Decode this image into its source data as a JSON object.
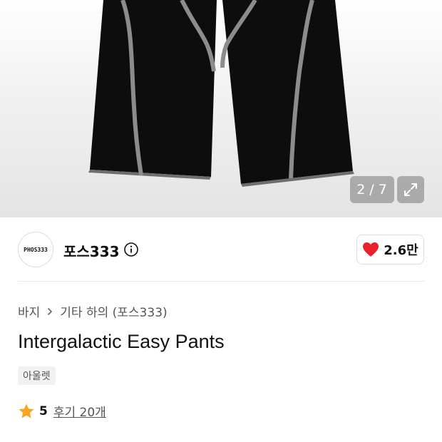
{
  "gallery": {
    "current": "2",
    "separator": "/",
    "total": "7",
    "expand_icon": "expand-arrows-icon"
  },
  "brand": {
    "logo_text": "PHOS333",
    "name": "포스333",
    "info_icon": "info-icon"
  },
  "likes": {
    "icon": "heart-icon",
    "count": "2.6만",
    "accent": "#e8212b"
  },
  "breadcrumb": {
    "items": [
      "바지",
      "기타 하의 (포스333)"
    ]
  },
  "product": {
    "title": "Intergalactic Easy Pants",
    "tag": "아울렛"
  },
  "rating": {
    "icon": "star-icon",
    "star_color": "#f5a623",
    "value": "5",
    "review_link": "후기 20개"
  }
}
